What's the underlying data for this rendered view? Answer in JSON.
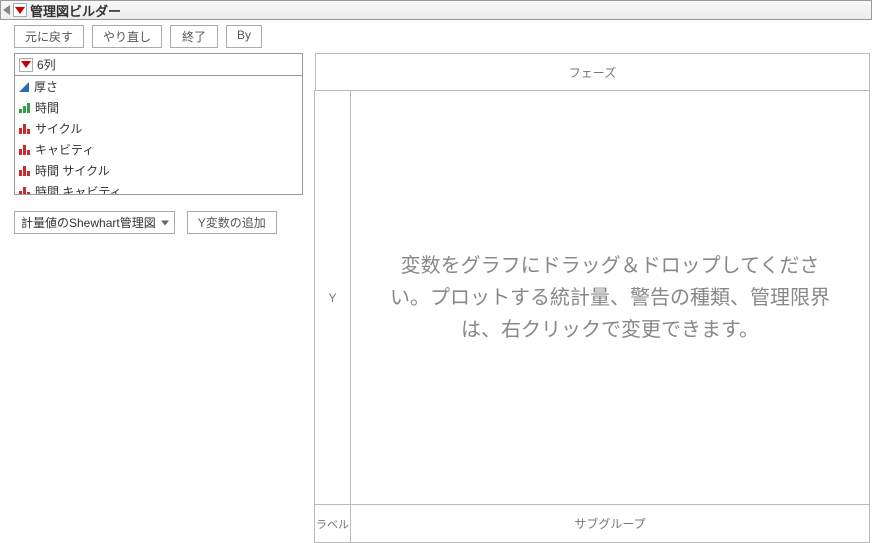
{
  "title": "管理図ビルダー",
  "toolbar": {
    "undo": "元に戻す",
    "redo": "やり直し",
    "done": "終了",
    "by": "By"
  },
  "columns": {
    "header": "6列",
    "items": [
      {
        "label": "厚さ",
        "icon": "continuous"
      },
      {
        "label": "時間",
        "icon": "ordinal-green"
      },
      {
        "label": "サイクル",
        "icon": "nominal-red"
      },
      {
        "label": "キャビティ",
        "icon": "nominal-red"
      },
      {
        "label": "時間 サイクル",
        "icon": "nominal-red"
      },
      {
        "label": "時間 キャビティ",
        "icon": "nominal-red"
      }
    ]
  },
  "controls": {
    "chart_type": "計量値のShewhart管理図",
    "add_y": "Y変数の追加"
  },
  "zones": {
    "phase": "フェーズ",
    "y": "Y",
    "drop_msg": "変数をグラフにドラッグ＆ドロップしてください。プロットする統計量、警告の種類、管理限界は、右クリックで変更できます。",
    "label": "ラベル",
    "subgroup": "サブグループ"
  }
}
